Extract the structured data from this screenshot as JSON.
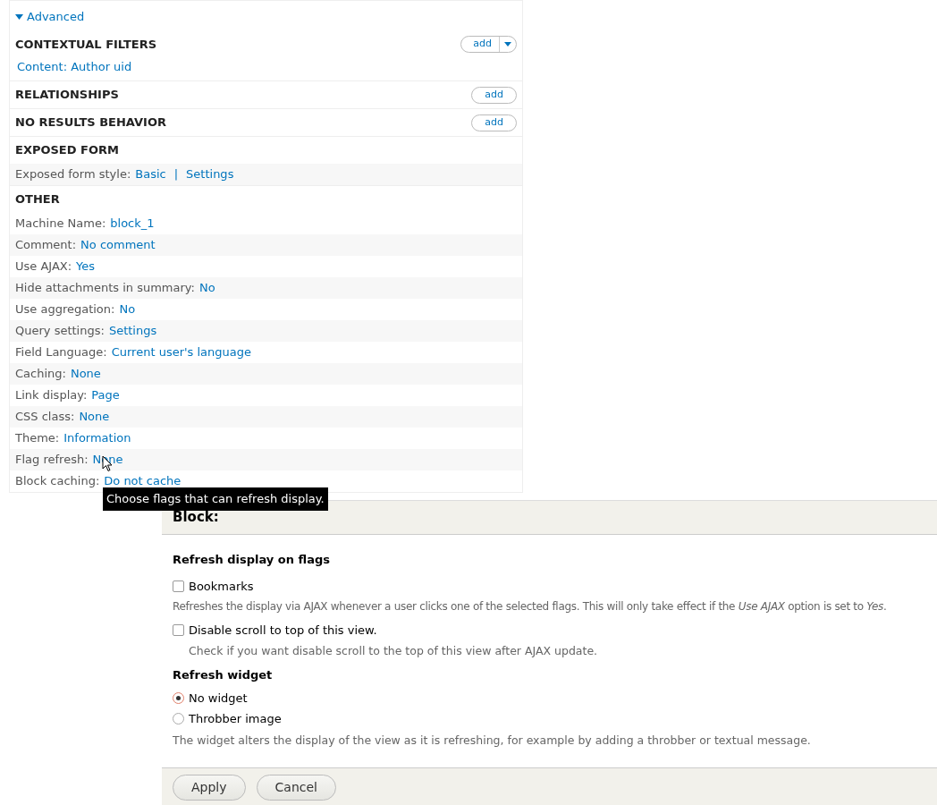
{
  "advanced": {
    "label": "Advanced",
    "expanded": true
  },
  "sections": [
    {
      "title": "CONTEXTUAL FILTERS",
      "add": {
        "label": "add",
        "dropdown": true
      },
      "links": [
        "Content: Author uid"
      ]
    },
    {
      "title": "RELATIONSHIPS",
      "add": {
        "label": "add",
        "dropdown": false
      }
    },
    {
      "title": "NO RESULTS BEHAVIOR",
      "add": {
        "label": "add",
        "dropdown": false
      }
    },
    {
      "title": "EXPOSED FORM",
      "rows": [
        {
          "label": "Exposed form style:",
          "values": [
            "Basic",
            "Settings"
          ],
          "separator": "|"
        }
      ]
    },
    {
      "title": "OTHER",
      "rows": [
        {
          "label": "Machine Name:",
          "values": [
            "block_1"
          ]
        },
        {
          "label": "Comment:",
          "values": [
            "No comment"
          ]
        },
        {
          "label": "Use AJAX:",
          "values": [
            "Yes"
          ]
        },
        {
          "label": "Hide attachments in summary:",
          "values": [
            "No"
          ]
        },
        {
          "label": "Use aggregation:",
          "values": [
            "No"
          ]
        },
        {
          "label": "Query settings:",
          "values": [
            "Settings"
          ]
        },
        {
          "label": "Field Language:",
          "values": [
            "Current user's language"
          ]
        },
        {
          "label": "Caching:",
          "values": [
            "None"
          ]
        },
        {
          "label": "Link display:",
          "values": [
            "Page"
          ]
        },
        {
          "label": "CSS class:",
          "values": [
            "None"
          ]
        },
        {
          "label": "Theme:",
          "values": [
            "Information"
          ]
        },
        {
          "label": "Flag refresh:",
          "values": [
            "None"
          ]
        },
        {
          "label": "Block caching:",
          "values": [
            "Do not cache"
          ]
        }
      ]
    }
  ],
  "tooltip": "Choose flags that can refresh display.",
  "dialog": {
    "title": "Block:",
    "flags_heading": "Refresh display on flags",
    "flags": [
      {
        "label": "Bookmarks",
        "checked": false
      }
    ],
    "flags_description": "Refreshes the display via AJAX whenever a user clicks one of the selected flags. This will only take effect if the *Use AJAX* option is set to *Yes*.",
    "disable_scroll": {
      "label": "Disable scroll to top of this view.",
      "checked": false,
      "description": "Check if you want disable scroll to the top of this view after AJAX update."
    },
    "widget_heading": "Refresh widget",
    "widgets": [
      {
        "label": "No widget",
        "selected": true
      },
      {
        "label": "Throbber image",
        "selected": false
      }
    ],
    "widget_description": "The widget alters the display of the view as it is refreshing, for example by adding a throbber or textual message.",
    "buttons": [
      "Apply",
      "Cancel"
    ]
  }
}
